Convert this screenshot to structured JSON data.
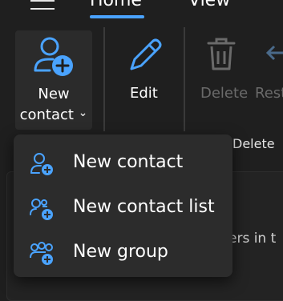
{
  "nav": {
    "tabs": [
      {
        "label": "Home",
        "selected": true
      },
      {
        "label": "View"
      }
    ]
  },
  "ribbon": {
    "new_button": {
      "line1": "New",
      "line2": "contact",
      "caret": "⌄"
    },
    "edit_label": "Edit",
    "delete_label": "Delete",
    "restore_label": "Rest",
    "sub_delete_label": "Delete"
  },
  "background": {
    "text_line1": "ers in t",
    "text_line2": "."
  },
  "menu": {
    "items": [
      {
        "label": "New contact",
        "icon": "person-add-icon"
      },
      {
        "label": "New contact list",
        "icon": "contact-list-add-icon"
      },
      {
        "label": "New group",
        "icon": "group-add-icon"
      }
    ]
  },
  "colors": {
    "accent": "#4aa3ff",
    "background": "#1f1f1f",
    "menu_bg": "#2c2c2c",
    "disabled": "#6a6a6a"
  }
}
